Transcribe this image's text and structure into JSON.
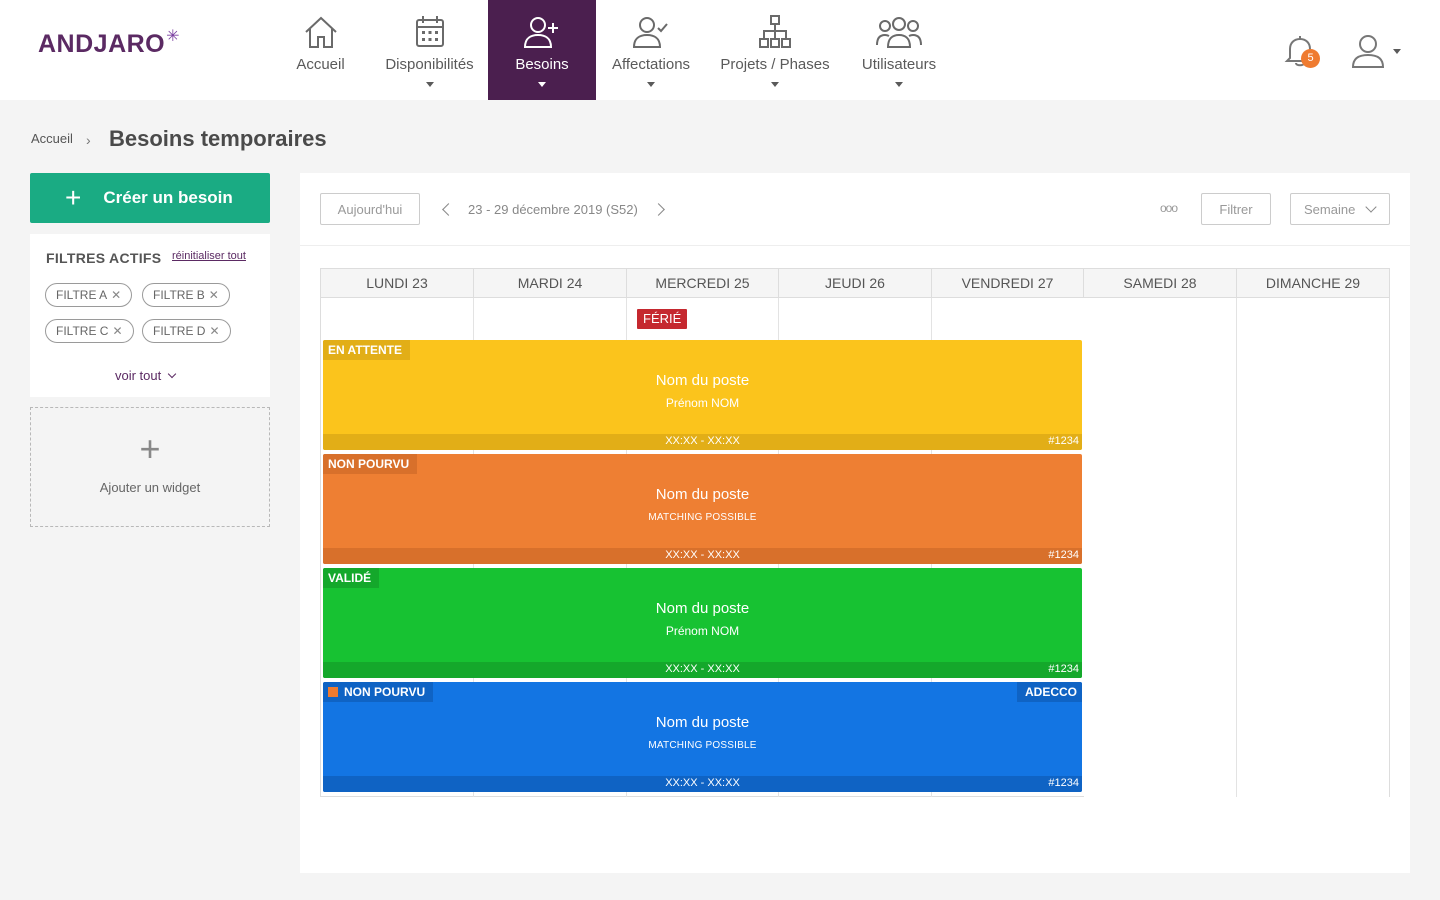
{
  "brand": {
    "name": "ANDJARO",
    "star": "✳"
  },
  "nav": [
    {
      "label": "Accueil",
      "icon": "home-icon"
    },
    {
      "label": "Disponibilités",
      "icon": "calendar-icon"
    },
    {
      "label": "Besoins",
      "icon": "user-plus-icon"
    },
    {
      "label": "Affectations",
      "icon": "user-check-icon"
    },
    {
      "label": "Projets / Phases",
      "icon": "hierarchy-icon"
    },
    {
      "label": "Utilisateurs",
      "icon": "users-icon"
    }
  ],
  "notifications": {
    "count": "5"
  },
  "breadcrumb": {
    "home": "Accueil",
    "sep": "›",
    "title": "Besoins temporaires"
  },
  "sidebar": {
    "create_label": "Créer un besoin",
    "create_plus": "+",
    "filters_title": "FILTRES ACTIFS",
    "reset_label": "réinitialiser tout",
    "chips": [
      "FILTRE A",
      "FILTRE B",
      "FILTRE C",
      "FILTRE D"
    ],
    "chip_close": "✕",
    "see_all": "voir tout",
    "widget_plus": "+",
    "widget_label": "Ajouter un widget"
  },
  "toolbar": {
    "today": "Aujourd'hui",
    "week": "23 - 29 décembre 2019 (S52)",
    "dots": "ooo",
    "filter": "Filtrer",
    "view": "Semaine"
  },
  "calendar": {
    "days": [
      "LUNDI 23",
      "MARDI 24",
      "MERCREDI 25",
      "JEUDI 26",
      "VENDREDI 27",
      "SAMEDI 28",
      "DIMANCHE 29"
    ],
    "holiday_label": "FÉRIÉ",
    "events": [
      {
        "status": "EN ATTENTE",
        "title": "Nom du poste",
        "subtitle": "Prénom NOM",
        "time": "XX:XX - XX:XX",
        "id": "#1234",
        "color": "#fbc41c",
        "footer_color": "#e2ae17",
        "tag_color": "#e2ae17"
      },
      {
        "status": "NON POURVU",
        "title": "Nom du poste",
        "subtitle": "MATCHING POSSIBLE",
        "time": "XX:XX - XX:XX",
        "id": "#1234",
        "color": "#ee7f33",
        "footer_color": "#d8702b",
        "tag_color": "#d8702b"
      },
      {
        "status": "VALIDÉ",
        "title": "Nom du poste",
        "subtitle": "Prénom NOM",
        "time": "XX:XX - XX:XX",
        "id": "#1234",
        "color": "#17c232",
        "footer_color": "#14a82b",
        "tag_color": "#14a82b"
      },
      {
        "status": "NON POURVU",
        "partner": "ADECCO",
        "title": "Nom du poste",
        "subtitle": "MATCHING POSSIBLE",
        "time": "XX:XX - XX:XX",
        "id": "#1234",
        "color": "#1375e3",
        "footer_color": "#0f63c4",
        "tag_color": "#0f63c4"
      }
    ]
  },
  "colors": {
    "brand": "#5b2a63",
    "active_nav": "#4b1f4f",
    "accent": "#1aab83",
    "badge": "#ef7b30",
    "holiday": "#c5282f"
  }
}
